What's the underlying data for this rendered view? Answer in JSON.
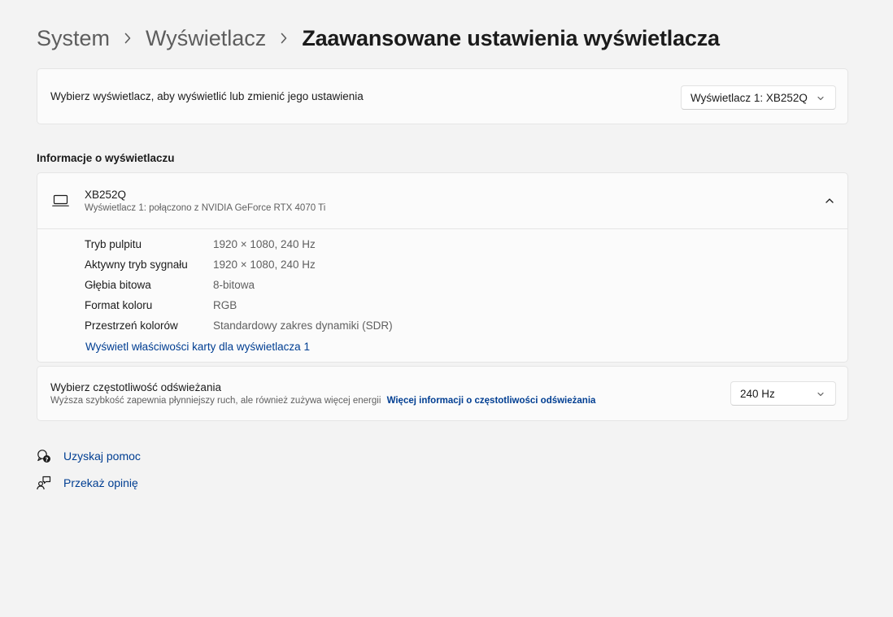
{
  "breadcrumb": {
    "items": [
      "System",
      "Wyświetlacz",
      "Zaawansowane ustawienia wyświetlacza"
    ]
  },
  "display_select": {
    "label": "Wybierz wyświetlacz, aby wyświetlić lub zmienić jego ustawienia",
    "value": "Wyświetlacz 1: XB252Q"
  },
  "display_info": {
    "section_title": "Informacje o wyświetlaczu",
    "monitor_name": "XB252Q",
    "monitor_subtitle": "Wyświetlacz 1: połączono z NVIDIA GeForce RTX 4070 Ti",
    "details": [
      {
        "label": "Tryb pulpitu",
        "value": "1920 × 1080, 240 Hz"
      },
      {
        "label": "Aktywny tryb sygnału",
        "value": "1920 × 1080, 240 Hz"
      },
      {
        "label": "Głębia bitowa",
        "value": "8-bitowa"
      },
      {
        "label": "Format koloru",
        "value": "RGB"
      },
      {
        "label": "Przestrzeń kolorów",
        "value": "Standardowy zakres dynamiki (SDR)"
      }
    ],
    "adapter_link": "Wyświetl właściwości karty dla wyświetlacza 1"
  },
  "refresh_rate": {
    "label": "Wybierz częstotliwość odświeżania",
    "description": "Wyższa szybkość zapewnia płynniejszy ruch, ale również zużywa więcej energii",
    "more_info_link": "Więcej informacji o częstotliwości odświeżania",
    "value": "240 Hz"
  },
  "footer": {
    "help_link": "Uzyskaj pomoc",
    "feedback_link": "Przekaż opinię"
  },
  "icons": {
    "breadcrumb_separator": "chevron-right-icon",
    "dropdown": "chevron-down-icon",
    "collapse": "chevron-up-icon",
    "monitor": "laptop-icon",
    "help": "help-icon",
    "feedback": "feedback-icon"
  },
  "colors": {
    "background": "#f3f3f3",
    "card": "#fbfbfb",
    "link": "#003e92",
    "secondary_text": "#5f5f5f"
  }
}
